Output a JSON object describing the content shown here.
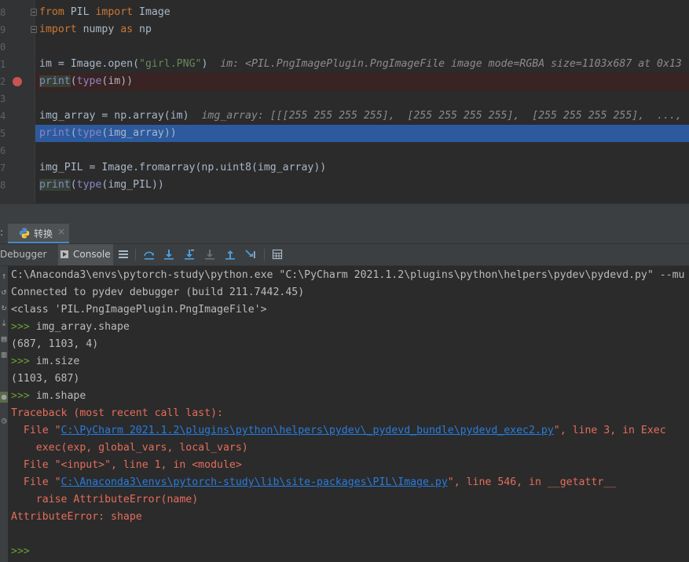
{
  "editor": {
    "lines": [
      {
        "num": "8",
        "fold": true,
        "tokens": [
          {
            "t": "from",
            "c": "kw"
          },
          {
            "t": " PIL "
          },
          {
            "t": "import",
            "c": "kw"
          },
          {
            "t": " Image"
          }
        ]
      },
      {
        "num": "9",
        "fold": true,
        "tokens": [
          {
            "t": "import",
            "c": "kw"
          },
          {
            "t": " numpy "
          },
          {
            "t": "as",
            "c": "kw"
          },
          {
            "t": " np"
          }
        ]
      },
      {
        "num": "0",
        "tokens": []
      },
      {
        "num": "1",
        "tokens": [
          {
            "t": "im = Image.open("
          },
          {
            "t": "\"girl.PNG\"",
            "c": "str"
          },
          {
            "t": ")  "
          },
          {
            "t": "im: <PIL.PngImagePlugin.PngImageFile image mode=RGBA size=1103x687 at 0x13",
            "c": "inlay"
          }
        ]
      },
      {
        "num": "2",
        "breakpoint": true,
        "hl": "bp",
        "tokens": [
          {
            "t": "print",
            "c": "bi call"
          },
          {
            "t": "("
          },
          {
            "t": "type",
            "c": "bi"
          },
          {
            "t": "(im))"
          }
        ]
      },
      {
        "num": "3",
        "tokens": []
      },
      {
        "num": "4",
        "tokens": [
          {
            "t": "img_array = np.array(im)  "
          },
          {
            "t": "img_array: [[[255 255 255 255],  [255 255 255 255],  [255 255 255 255],  ...,",
            "c": "inlay"
          }
        ]
      },
      {
        "num": "5",
        "hl": "exec",
        "tokens": [
          {
            "t": "print",
            "c": "bi"
          },
          {
            "t": "("
          },
          {
            "t": "type",
            "c": "bi"
          },
          {
            "t": "(img_array))"
          }
        ]
      },
      {
        "num": "6",
        "tokens": []
      },
      {
        "num": "7",
        "tokens": [
          {
            "t": "img_PIL = Image.fromarray(np.uint8(img_array))"
          }
        ]
      },
      {
        "num": "8",
        "tokens": [
          {
            "t": "print",
            "c": "bi call"
          },
          {
            "t": "("
          },
          {
            "t": "type",
            "c": "bi"
          },
          {
            "t": "(img_PIL))"
          }
        ]
      }
    ]
  },
  "runbar": {
    "prefix": ":",
    "tab_label": "转换",
    "close_glyph": "×"
  },
  "toolbar": {
    "debugger_label": "Debugger",
    "console_label": "Console",
    "icons": [
      "list-icon",
      "step-over-icon",
      "step-into-icon",
      "step-into-my-code-icon",
      "force-step-into-icon",
      "step-out-icon",
      "run-to-cursor-icon",
      "evaluate-expression-icon"
    ]
  },
  "console": {
    "lines": [
      {
        "cls": "plain",
        "parts": [
          {
            "t": "C:\\Anaconda3\\envs\\pytorch-study\\python.exe \"C:\\PyCharm 2021.1.2\\plugins\\python\\helpers\\pydev\\pydevd.py\" --mu"
          }
        ]
      },
      {
        "cls": "plain",
        "parts": [
          {
            "t": "Connected to pydev debugger (build 211.7442.45)"
          }
        ]
      },
      {
        "cls": "plain",
        "parts": [
          {
            "t": "<class 'PIL.PngImagePlugin.PngImageFile'>"
          }
        ]
      },
      {
        "cls": "plain",
        "parts": [
          {
            "t": ">>> ",
            "c": "prompt"
          },
          {
            "t": "img_array.shape"
          }
        ]
      },
      {
        "cls": "plain",
        "parts": [
          {
            "t": "(687, 1103, 4)"
          }
        ]
      },
      {
        "cls": "plain",
        "parts": [
          {
            "t": ">>> ",
            "c": "prompt"
          },
          {
            "t": "im.size"
          }
        ]
      },
      {
        "cls": "plain",
        "parts": [
          {
            "t": "(1103, 687)"
          }
        ]
      },
      {
        "cls": "plain",
        "parts": [
          {
            "t": ">>> ",
            "c": "prompt"
          },
          {
            "t": "im.shape"
          }
        ]
      },
      {
        "cls": "err",
        "parts": [
          {
            "t": "Traceback (most recent call last):"
          }
        ]
      },
      {
        "cls": "err",
        "parts": [
          {
            "t": "  File \""
          },
          {
            "t": "C:\\PyCharm 2021.1.2\\plugins\\python\\helpers\\pydev\\_pydevd_bundle\\pydevd_exec2.py",
            "c": "link"
          },
          {
            "t": "\", line 3, in Exec"
          }
        ]
      },
      {
        "cls": "err",
        "parts": [
          {
            "t": "    exec(exp, global_vars, local_vars)"
          }
        ]
      },
      {
        "cls": "err",
        "parts": [
          {
            "t": "  File \"<input>\", line 1, in <module>"
          }
        ]
      },
      {
        "cls": "err",
        "parts": [
          {
            "t": "  File \""
          },
          {
            "t": "C:\\Anaconda3\\envs\\pytorch-study\\lib\\site-packages\\PIL\\Image.py",
            "c": "link"
          },
          {
            "t": "\", line 546, in __getattr__"
          }
        ]
      },
      {
        "cls": "err",
        "parts": [
          {
            "t": "    raise AttributeError(name)"
          }
        ]
      },
      {
        "cls": "err",
        "parts": [
          {
            "t": "AttributeError: shape"
          }
        ]
      },
      {
        "cls": "plain",
        "parts": [
          {
            "t": ""
          }
        ]
      },
      {
        "cls": "plain",
        "parts": [
          {
            "t": ">>>",
            "c": "prompt"
          }
        ]
      }
    ]
  },
  "colors": {
    "background": "#2b2b2b",
    "keyword": "#cc7832",
    "string": "#6a8759",
    "builtin": "#8888c6",
    "error": "#e46d5c",
    "link": "#287bde",
    "prompt": "#6a9f3b",
    "exec_line": "#2d5a9e",
    "breakpoint": "#c75450"
  }
}
